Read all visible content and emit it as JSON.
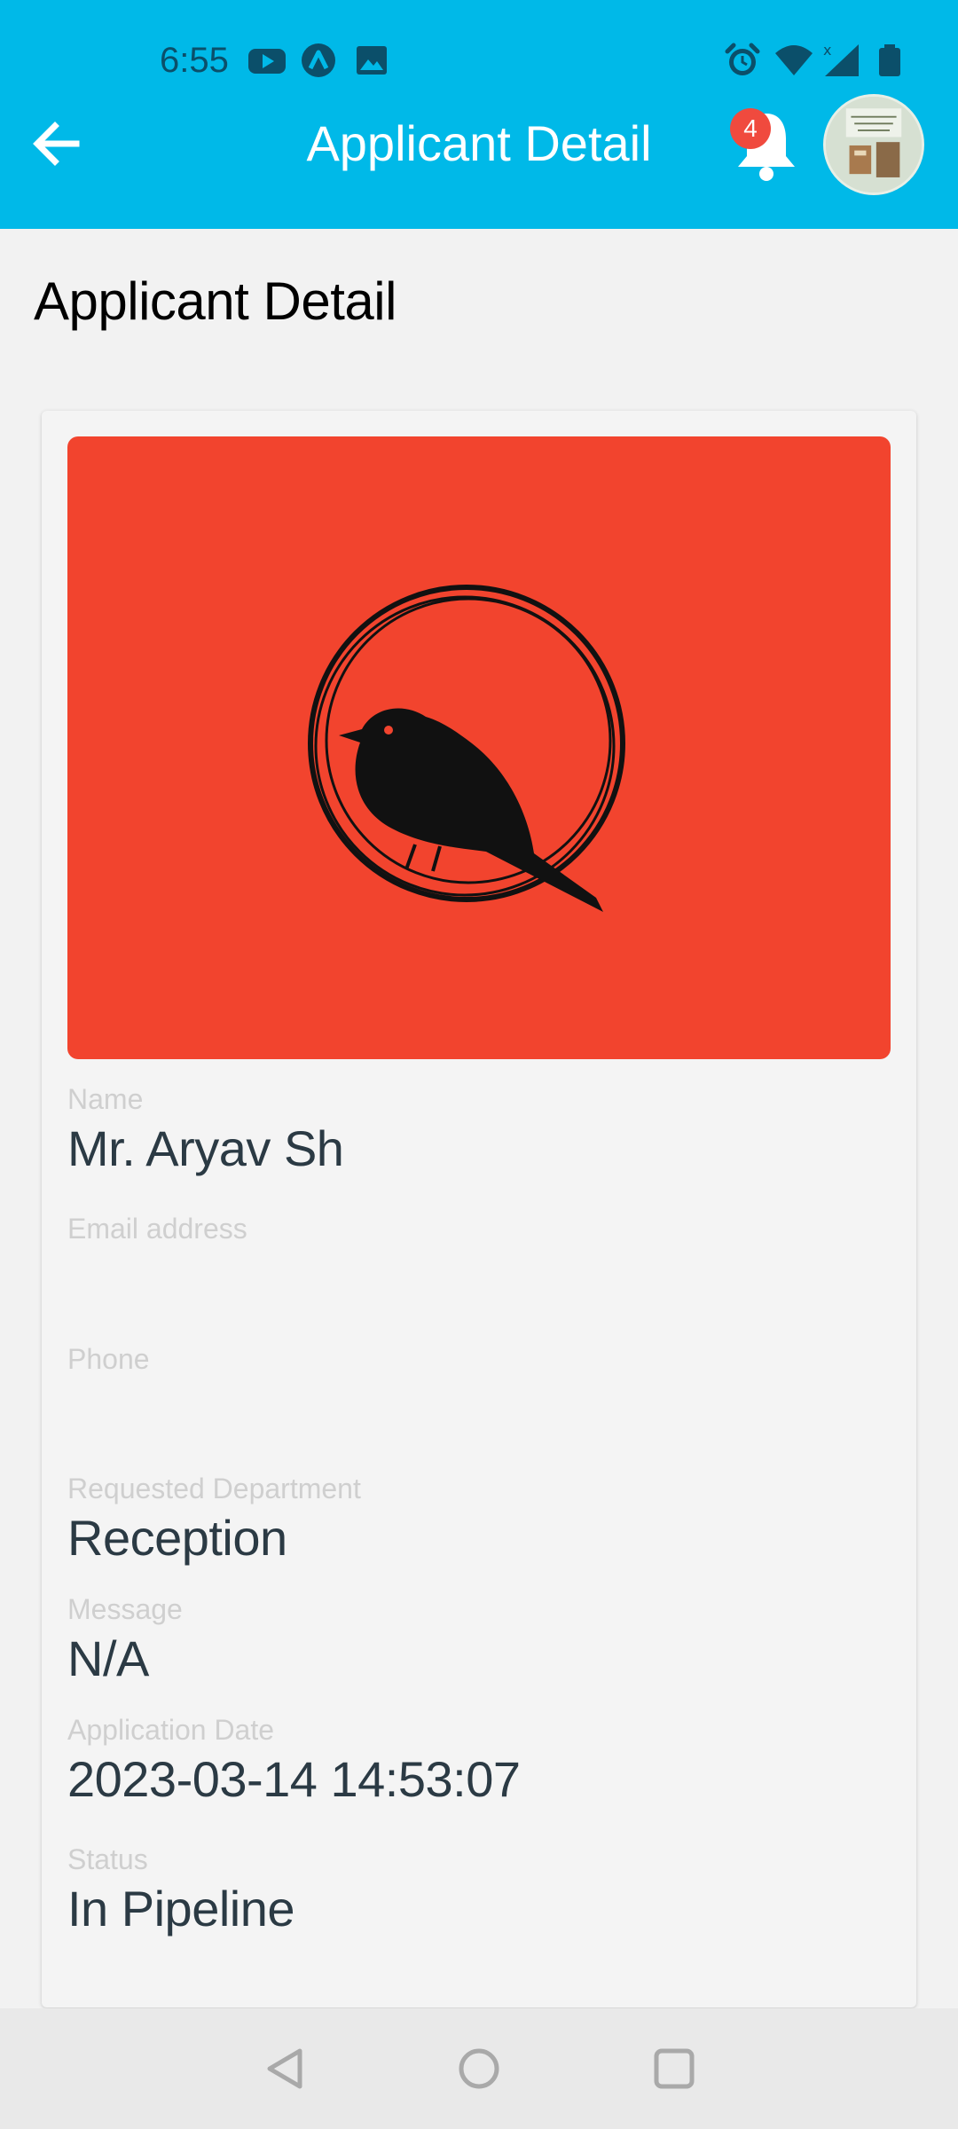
{
  "status_bar": {
    "time": "6:55",
    "left_icons": [
      "youtube-icon",
      "app-a-icon",
      "image-icon"
    ],
    "right_icons": [
      "alarm-icon",
      "wifi-icon",
      "signal-icon",
      "battery-icon"
    ]
  },
  "app_bar": {
    "title": "Applicant Detail",
    "back_icon": "arrow-left-icon",
    "notification_count": "4",
    "accent_color": "#00b9e8"
  },
  "page": {
    "title": "Applicant Detail"
  },
  "applicant": {
    "photo_background": "#f2442e",
    "photo_icon": "bird-in-circle-logo",
    "fields": {
      "name": {
        "label": "Name",
        "value": "Mr. Aryav Sh"
      },
      "email": {
        "label": "Email address",
        "value": ""
      },
      "phone": {
        "label": "Phone",
        "value": ""
      },
      "department": {
        "label": "Requested Department",
        "value": "Reception"
      },
      "message": {
        "label": "Message",
        "value": "N/A"
      },
      "date": {
        "label": "Application Date",
        "value": "2023-03-14 14:53:07"
      },
      "status": {
        "label": "Status",
        "value": "In Pipeline"
      }
    }
  },
  "nav_bar": {
    "buttons": [
      "back-triangle-icon",
      "home-circle-icon",
      "recents-square-icon"
    ]
  }
}
